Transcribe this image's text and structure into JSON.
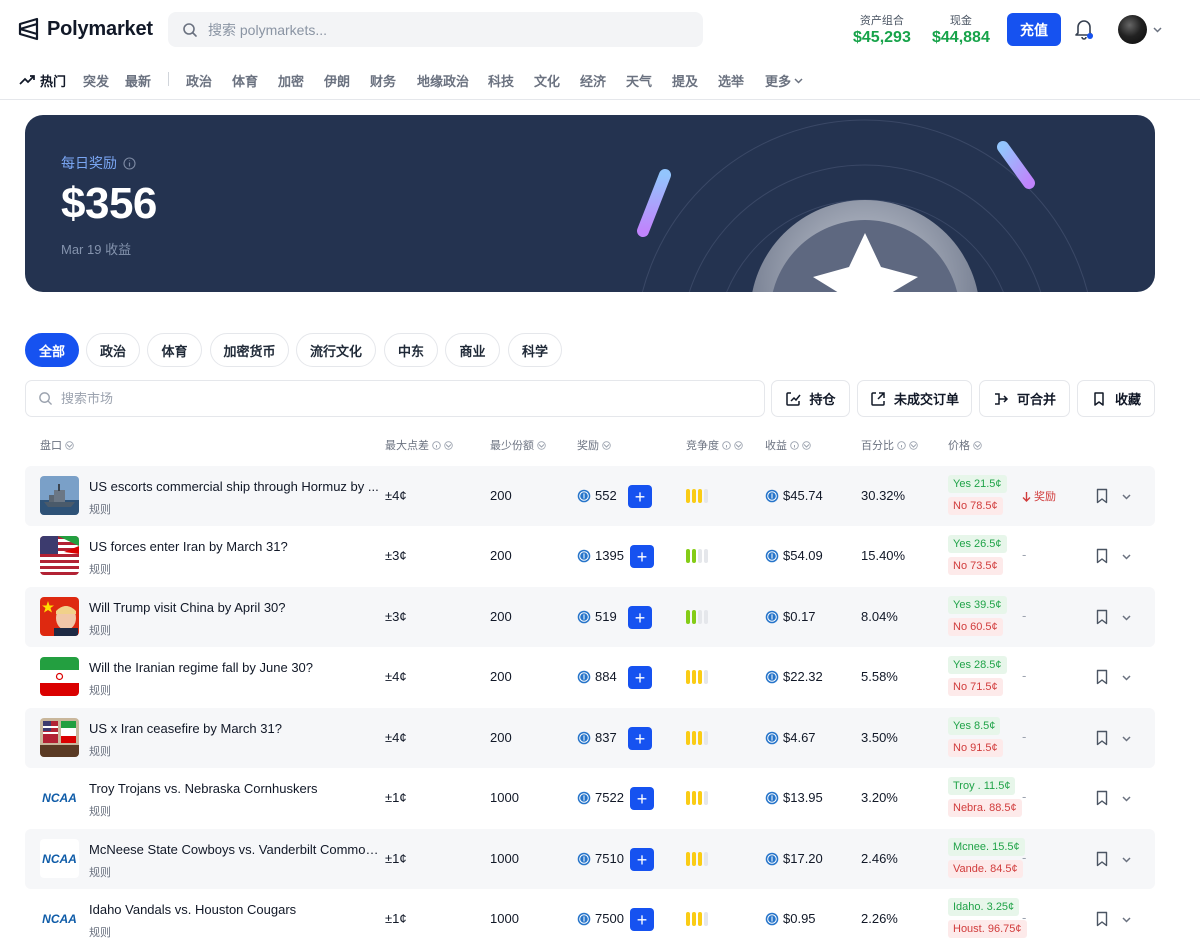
{
  "header": {
    "brand": "Polymarket",
    "search_placeholder": "搜索 polymarkets...",
    "portfolio_label": "资产组合",
    "portfolio_value": "$45,293",
    "cash_label": "现金",
    "cash_value": "$44,884",
    "deposit_label": "充值"
  },
  "nav": {
    "items": [
      "热门",
      "突发",
      "最新",
      "政治",
      "体育",
      "加密",
      "伊朗",
      "财务",
      "地缘政治",
      "科技",
      "文化",
      "经济",
      "天气",
      "提及",
      "选举",
      "更多"
    ],
    "active": "热门"
  },
  "banner": {
    "label": "每日奖励",
    "amount": "$356",
    "sub": "Mar 19 收益"
  },
  "categories": {
    "items": [
      "全部",
      "政治",
      "体育",
      "加密货币",
      "流行文化",
      "中东",
      "商业",
      "科学"
    ],
    "active": "全部"
  },
  "filters": {
    "search_placeholder": "搜索市场",
    "positions": "持仓",
    "open_orders": "未成交订单",
    "mergeable": "可合并",
    "favorites": "收藏"
  },
  "table": {
    "headers": {
      "market": "盘口",
      "max_spread": "最大点差",
      "min_shares": "最少份额",
      "reward": "奖励",
      "competition": "竞争度",
      "earnings": "收益",
      "percent": "百分比",
      "price": "价格"
    },
    "rows": [
      {
        "title": "US escorts commercial ship through Hormuz by ...",
        "rules": "规则",
        "spread": "±4¢",
        "min_shares": "200",
        "reward": "552",
        "competition": 3,
        "earnings": "$45.74",
        "pct": "30.32%",
        "yes": "Yes 21.5¢",
        "no": "No 78.5¢",
        "trend": "奖励",
        "thumb": "ship"
      },
      {
        "title": "US forces enter Iran by March 31?",
        "rules": "规则",
        "spread": "±3¢",
        "min_shares": "200",
        "reward": "1395",
        "competition": 2,
        "earnings": "$54.09",
        "pct": "15.40%",
        "yes": "Yes 26.5¢",
        "no": "No 73.5¢",
        "trend": "-",
        "thumb": "us-iran-flag"
      },
      {
        "title": "Will Trump visit China by April 30?",
        "rules": "规则",
        "spread": "±3¢",
        "min_shares": "200",
        "reward": "519",
        "competition": 2,
        "earnings": "$0.17",
        "pct": "8.04%",
        "yes": "Yes 39.5¢",
        "no": "No 60.5¢",
        "trend": "-",
        "thumb": "trump-china"
      },
      {
        "title": "Will the Iranian regime fall by June 30?",
        "rules": "规则",
        "spread": "±4¢",
        "min_shares": "200",
        "reward": "884",
        "competition": 3,
        "earnings": "$22.32",
        "pct": "5.58%",
        "yes": "Yes 28.5¢",
        "no": "No 71.5¢",
        "trend": "-",
        "thumb": "iran-flag"
      },
      {
        "title": "US x Iran ceasefire by March 31?",
        "rules": "规则",
        "spread": "±4¢",
        "min_shares": "200",
        "reward": "837",
        "competition": 3,
        "earnings": "$4.67",
        "pct": "3.50%",
        "yes": "Yes 8.5¢",
        "no": "No 91.5¢",
        "trend": "-",
        "thumb": "flags-meeting"
      },
      {
        "title": "Troy Trojans vs. Nebraska Cornhuskers",
        "rules": "规则",
        "spread": "±1¢",
        "min_shares": "1000",
        "reward": "7522",
        "competition": 3,
        "earnings": "$13.95",
        "pct": "3.20%",
        "yes": "Troy . 11.5¢",
        "no": "Nebra. 88.5¢",
        "trend": "-",
        "thumb": "ncaa"
      },
      {
        "title": "McNeese State Cowboys vs. Vanderbilt Commod...",
        "rules": "规则",
        "spread": "±1¢",
        "min_shares": "1000",
        "reward": "7510",
        "competition": 3,
        "earnings": "$17.20",
        "pct": "2.46%",
        "yes": "Mcnee. 15.5¢",
        "no": "Vande. 84.5¢",
        "trend": "-",
        "thumb": "ncaa"
      },
      {
        "title": "Idaho Vandals vs. Houston Cougars",
        "rules": "规则",
        "spread": "±1¢",
        "min_shares": "1000",
        "reward": "7500",
        "competition": 3,
        "earnings": "$0.95",
        "pct": "2.26%",
        "yes": "Idaho. 3.25¢",
        "no": "Houst. 96.75¢",
        "trend": "-",
        "thumb": "ncaa"
      }
    ]
  },
  "colors": {
    "accent": "#1652f0",
    "positive": "#17a34a",
    "negative": "#d13c3c",
    "banner_bg": "#243350"
  }
}
